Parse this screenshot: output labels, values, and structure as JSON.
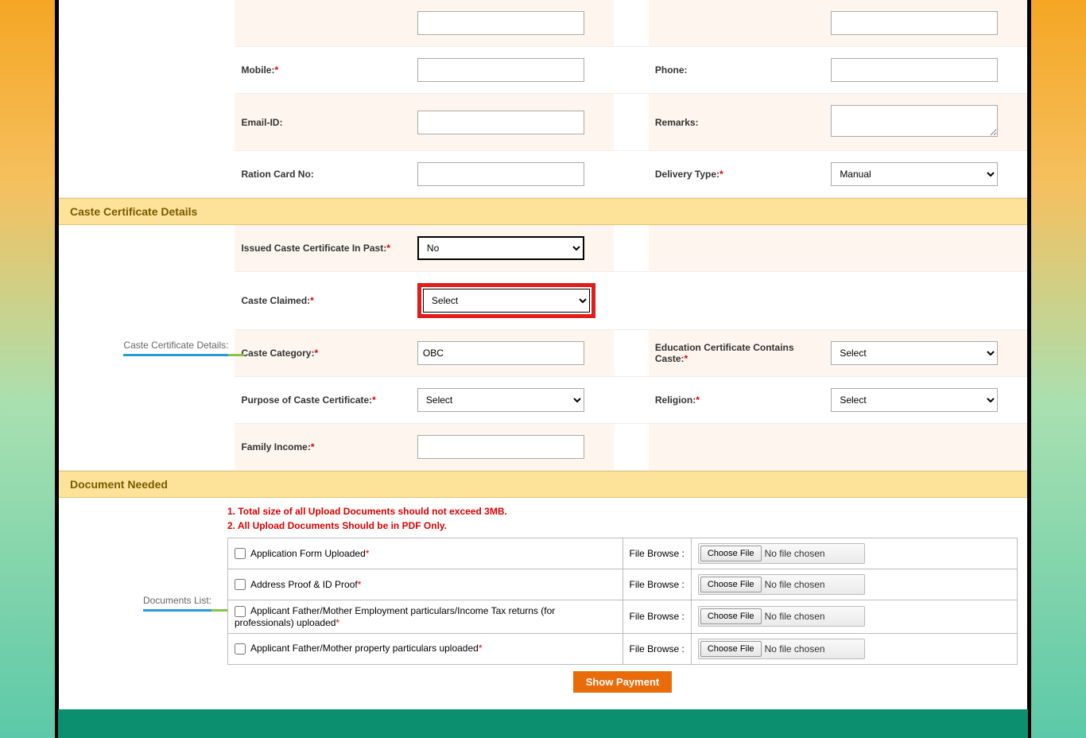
{
  "personal": {
    "mobile_label": "Mobile:",
    "phone_label": "Phone:",
    "email_label": "Email-ID:",
    "remarks_label": "Remarks:",
    "ration_label": "Ration Card No:",
    "delivery_label": "Delivery Type:",
    "delivery_value": "Manual"
  },
  "caste_section_title": "Caste Certificate Details",
  "caste_side_label": "Caste Certificate Details:",
  "caste": {
    "issued_label": "Issued Caste Certificate In Past:",
    "issued_value": "No",
    "claimed_label": "Caste Claimed:",
    "claimed_value": "Select",
    "category_label": "Caste Category:",
    "category_value": "OBC",
    "edu_label": "Education Certificate Contains Caste:",
    "edu_value": "Select",
    "purpose_label": "Purpose of Caste Certificate:",
    "purpose_value": "Select",
    "religion_label": "Religion:",
    "religion_value": "Select",
    "income_label": "Family Income:"
  },
  "doc_section_title": "Document Needed",
  "doc_side_label": "Documents List:",
  "doc_notes": [
    "1. Total size of all Upload Documents should not exceed 3MB.",
    "2. All Upload Documents Should be in PDF Only."
  ],
  "file_browse_label": "File Browse :",
  "choose_file_label": "Choose File",
  "no_file_chosen": "No file chosen",
  "docs": [
    {
      "label": "Application Form Uploaded"
    },
    {
      "label": "Address Proof & ID Proof"
    },
    {
      "label": "Applicant Father/Mother Employment particulars/Income Tax returns (for professionals) uploaded"
    },
    {
      "label": "Applicant Father/Mother property particulars uploaded"
    }
  ],
  "show_payment_label": "Show Payment"
}
